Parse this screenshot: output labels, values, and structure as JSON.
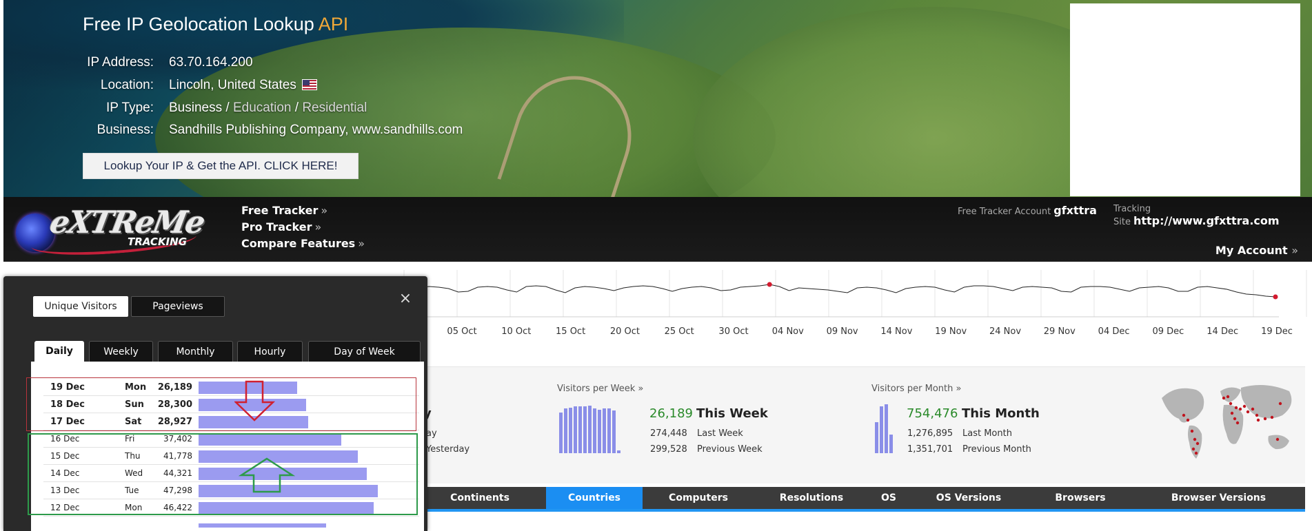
{
  "hero": {
    "title_main": "Free IP Geolocation Lookup ",
    "title_api": "API",
    "rows": [
      {
        "label": "IP Address:",
        "value": "63.70.164.200"
      },
      {
        "label": "Location:",
        "value": "Lincoln, United States"
      },
      {
        "label": "IP Type:",
        "value_business": "Business",
        "sep1": " / ",
        "value_education": "Education",
        "sep2": " / ",
        "value_residential": "Residential"
      },
      {
        "label": "Business:",
        "value": "Sandhills Publishing Company, www.sandhills.com"
      }
    ],
    "cta": "Lookup Your IP & Get the API. CLICK HERE!"
  },
  "tracker": {
    "logo_text": "eXTReMe",
    "logo_sub": "TRACKING",
    "nav": [
      {
        "label": "Free Tracker",
        "arrows": "»"
      },
      {
        "label": "Pro Tracker",
        "arrows": "»"
      },
      {
        "label": "Compare Features",
        "arrows": "»"
      }
    ],
    "account_label": "Free Tracker Account",
    "account_value": "gfxttra",
    "site_label": "Tracking Site",
    "site_value": "http://www.gfxttra.com",
    "my_account": "My Account",
    "my_account_arrows": "»"
  },
  "timeline": {
    "date_labels": [
      "05 Oct",
      "10 Oct",
      "15 Oct",
      "20 Oct",
      "25 Oct",
      "30 Oct",
      "04 Nov",
      "09 Nov",
      "14 Nov",
      "19 Nov",
      "24 Nov",
      "29 Nov",
      "04 Dec",
      "09 Dec",
      "14 Dec",
      "19 Dec"
    ],
    "series": [
      38,
      40,
      42,
      44,
      43,
      41,
      36,
      37,
      43,
      44,
      43,
      39,
      36,
      44,
      45,
      44,
      39,
      35,
      42,
      44,
      43,
      41,
      38,
      42,
      44,
      45,
      44,
      41,
      37,
      41,
      43,
      44,
      42,
      38,
      39,
      43,
      44,
      45,
      47,
      44,
      38,
      42,
      41,
      40,
      39,
      37,
      35,
      42,
      43,
      42,
      39,
      35,
      41,
      43,
      44,
      43,
      39,
      36,
      43,
      45,
      45,
      44,
      41,
      38,
      43,
      44,
      43,
      42,
      37,
      36,
      43,
      44,
      44,
      43,
      40,
      37,
      42,
      43,
      44,
      42,
      37,
      37,
      43,
      44,
      42,
      40,
      36,
      33,
      32,
      30,
      29
    ],
    "highlight_color": "#d31b2f",
    "line_color": "#222222"
  },
  "stats": {
    "day_partial": "y",
    "day_rows": [
      "ay",
      "Yesterday"
    ],
    "week": {
      "header": "Visitors per Week »",
      "value": "26,189",
      "period": "This Week",
      "rows": [
        {
          "num": "274,448",
          "name": "Last Week"
        },
        {
          "num": "299,528",
          "name": "Previous Week"
        }
      ],
      "bars": [
        0.82,
        0.9,
        0.92,
        0.94,
        0.95,
        0.95,
        0.96,
        0.9,
        0.88,
        0.9,
        0.9,
        0.86,
        0.06
      ]
    },
    "month": {
      "header": "Visitors per Month »",
      "value": "754,476",
      "period": "This Month",
      "rows": [
        {
          "num": "1,276,895",
          "name": "Last Month"
        },
        {
          "num": "1,351,701",
          "name": "Previous Month"
        }
      ],
      "bars": [
        0.62,
        0.95,
        0.98,
        0.38
      ]
    }
  },
  "bottom_tabs": [
    "Continents",
    "Countries",
    "Computers",
    "Resolutions",
    "OS",
    "OS Versions",
    "Browsers",
    "Browser Versions"
  ],
  "bottom_tabs_active": "Countries",
  "panel": {
    "close": "×",
    "toggle_on": "Unique Visitors",
    "toggle_off": "Pageviews",
    "tabs": [
      "Daily",
      "Weekly",
      "Monthly",
      "Hourly",
      "Day of Week"
    ],
    "tab_active": "Daily",
    "days": [
      {
        "date": "19 Dec",
        "weekday": "Mon",
        "value": "26,189",
        "level": 0.54
      },
      {
        "date": "18 Dec",
        "weekday": "Sun",
        "value": "28,300",
        "level": 0.59
      },
      {
        "date": "17 Dec",
        "weekday": "Sat",
        "value": "28,927",
        "level": 0.6
      },
      {
        "date": "16 Dec",
        "weekday": "Fri",
        "value": "37,402",
        "level": 0.78
      },
      {
        "date": "15 Dec",
        "weekday": "Thu",
        "value": "41,778",
        "level": 0.87
      },
      {
        "date": "14 Dec",
        "weekday": "Wed",
        "value": "44,321",
        "level": 0.92
      },
      {
        "date": "13 Dec",
        "weekday": "Tue",
        "value": "47,298",
        "level": 0.98
      },
      {
        "date": "12 Dec",
        "weekday": "Mon",
        "value": "46,422",
        "level": 0.96
      }
    ]
  }
}
